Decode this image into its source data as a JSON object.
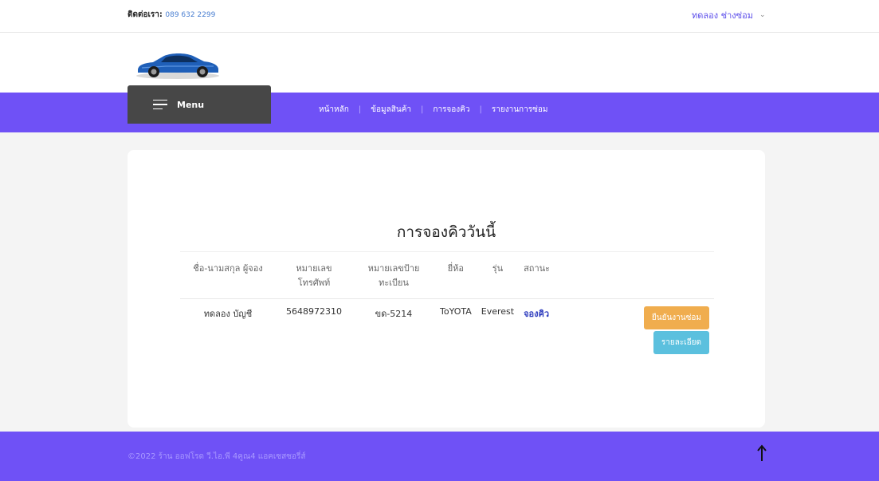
{
  "topbar": {
    "contact_label": "ติดต่อเรา:",
    "contact_phone": "089 632 2299",
    "user_name": "ทดลอง ช่างซ่อม",
    "user_chevron_icon": "chevron-down-icon"
  },
  "brand": {
    "logo_icon": "car-logo-icon",
    "colors": {
      "car": "#1f5fb8",
      "accent": "#6f51f6",
      "menu_bg": "#474747"
    }
  },
  "nav": {
    "menu_label": "Menu",
    "menu_icon": "hamburger-icon",
    "links": [
      {
        "label": "หน้าหลัก"
      },
      {
        "label": "ข้อมูลสินค้า"
      },
      {
        "label": "การจองคิว"
      },
      {
        "label": "รายงานการซ่อม"
      }
    ]
  },
  "main": {
    "title": "การจองคิววันนี้",
    "table": {
      "headers": [
        "ชื่อ-นามสกุล ผู้จอง",
        "หมายเลขโทรศัพท์",
        "หมายเลขป้ายทะเบียน",
        "ยี่ห้อ",
        "รุ่น",
        "สถานะ"
      ],
      "rows": [
        {
          "name": "ทดลอง บัญชี",
          "phone": "5648972310",
          "plate": "ขด-5214",
          "brand": "ToYOTA",
          "model": "Everest",
          "status": "จองคิว",
          "confirm_button": "ยืนยันงานซ่อม",
          "detail_button": "รายละเอียด"
        }
      ]
    }
  },
  "footer": {
    "copyright": "©2022 ร้าน ออฟโรด วี.ไอ.พี 4คูณ4 แอคเซสซอรี่ส์",
    "scroll_top_icon": "arrow-up-icon"
  }
}
